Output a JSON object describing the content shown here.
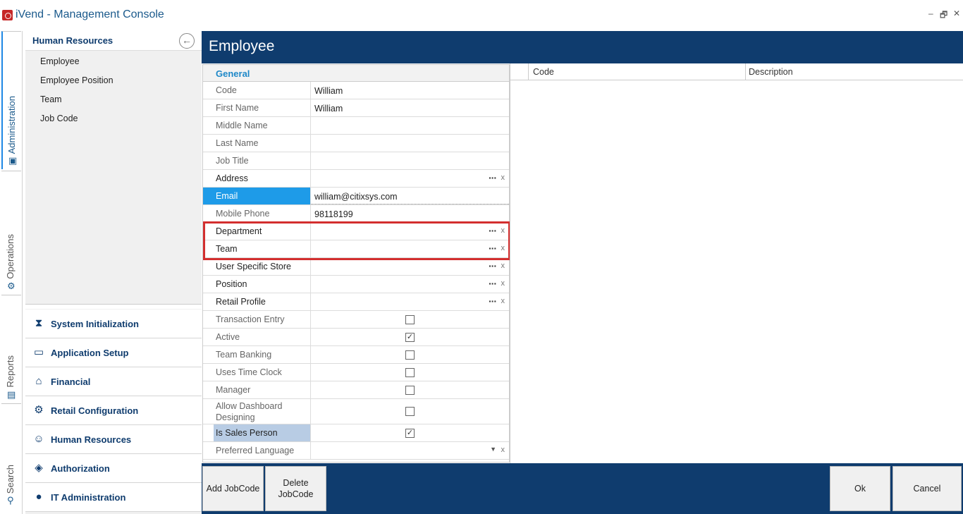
{
  "window": {
    "title": "iVend - Management Console",
    "controls": {
      "minimize": "–",
      "restore": "🗗",
      "close": "✕"
    }
  },
  "rail": {
    "tabs": [
      {
        "label": "Administration",
        "icon": "admin-icon",
        "active": true
      },
      {
        "label": "Operations",
        "icon": "gear-icon",
        "active": false
      },
      {
        "label": "Reports",
        "icon": "report-icon",
        "active": false
      },
      {
        "label": "Search",
        "icon": "search-icon",
        "active": false
      }
    ]
  },
  "sidebar": {
    "header": "Human Resources",
    "items": [
      "Employee",
      "Employee Position",
      "Team",
      "Job Code"
    ],
    "modules": [
      {
        "label": "System Initialization",
        "icon": "hourglass-icon"
      },
      {
        "label": "Application Setup",
        "icon": "terminal-icon"
      },
      {
        "label": "Financial",
        "icon": "bank-icon"
      },
      {
        "label": "Retail Configuration",
        "icon": "gears-icon"
      },
      {
        "label": "Human Resources",
        "icon": "user-search-icon"
      },
      {
        "label": "Authorization",
        "icon": "shield-icon"
      },
      {
        "label": "IT Administration",
        "icon": "user-icon"
      }
    ]
  },
  "main": {
    "title": "Employee",
    "group": "General",
    "fields": {
      "code": {
        "label": "Code",
        "value": "William"
      },
      "first_name": {
        "label": "First Name",
        "value": "William"
      },
      "middle_name": {
        "label": "Middle Name",
        "value": ""
      },
      "last_name": {
        "label": "Last Name",
        "value": ""
      },
      "job_title": {
        "label": "Job Title",
        "value": ""
      },
      "address": {
        "label": "Address",
        "value": ""
      },
      "email": {
        "label": "Email",
        "value": "william@citixsys.com"
      },
      "mobile_phone": {
        "label": "Mobile Phone",
        "value": "98118199"
      },
      "department": {
        "label": "Department",
        "value": ""
      },
      "team": {
        "label": "Team",
        "value": ""
      },
      "user_specific_store": {
        "label": "User Specific Store",
        "value": ""
      },
      "position": {
        "label": "Position",
        "value": ""
      },
      "retail_profile": {
        "label": "Retail Profile",
        "value": ""
      },
      "transaction_entry": {
        "label": "Transaction Entry",
        "checked": false
      },
      "active": {
        "label": "Active",
        "checked": true
      },
      "team_banking": {
        "label": "Team Banking",
        "checked": false
      },
      "uses_time_clock": {
        "label": "Uses Time Clock",
        "checked": false
      },
      "manager": {
        "label": "Manager",
        "checked": false
      },
      "allow_dashboard": {
        "label": "Allow Dashboard Designing",
        "checked": false
      },
      "is_sales_person": {
        "label": "Is Sales Person",
        "checked": true
      },
      "preferred_language": {
        "label": "Preferred Language",
        "value": ""
      }
    },
    "ellipsis": "···",
    "clear": "x",
    "dropdown": "▼",
    "check_mark": "✓",
    "grid": {
      "columns": [
        "Code",
        "Description"
      ]
    },
    "footer": {
      "add_jobcode": "Add JobCode",
      "delete_jobcode_1": "Delete",
      "delete_jobcode_2": "JobCode",
      "ok": "Ok",
      "cancel": "Cancel"
    }
  }
}
